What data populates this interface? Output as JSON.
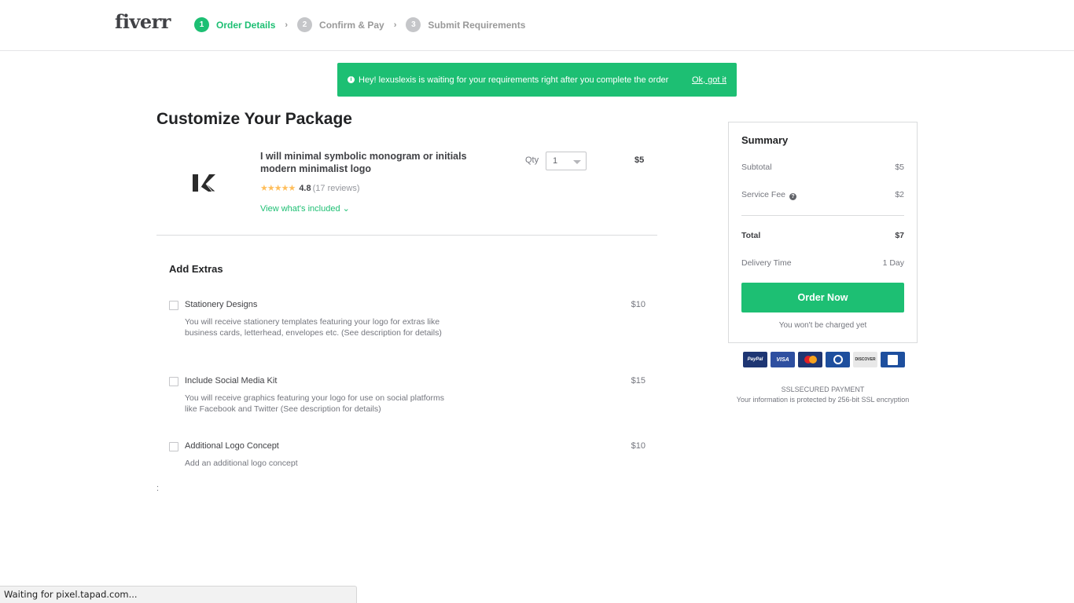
{
  "header": {
    "logo": "fiverr",
    "steps": [
      {
        "num": "1",
        "label": "Order Details",
        "active": true
      },
      {
        "num": "2",
        "label": "Confirm & Pay",
        "active": false
      },
      {
        "num": "3",
        "label": "Submit Requirements",
        "active": false
      }
    ],
    "step_separator": "›"
  },
  "banner": {
    "icon": "info-icon",
    "message": "Hey! lexuslexis is waiting for your requirements right after you complete the order",
    "dismiss_label": "Ok, got it",
    "color": "#1dbf73"
  },
  "page": {
    "title": "Customize Your Package"
  },
  "gig": {
    "title": "I will minimal symbolic monogram or initials modern minimalist logo",
    "stars": "★★★★★",
    "rating": "4.8",
    "reviews": "(17 reviews)",
    "view_included": "View what's included ⌄",
    "qty_label": "Qty",
    "qty_value": "1",
    "price": "$5"
  },
  "extras": {
    "title": "Add Extras",
    "items": [
      {
        "name": "Stationery Designs",
        "description": "You will receive stationery templates featuring your logo for extras like business cards, letterhead, envelopes etc. (See description for details)",
        "price": "$10",
        "checked": false
      },
      {
        "name": "Include Social Media Kit",
        "description": "You will receive graphics featuring your logo for use on social platforms like Facebook and Twitter (See description for details)",
        "price": "$15",
        "checked": false
      },
      {
        "name": "Additional Logo Concept",
        "description": "Add an additional logo concept",
        "price": "$10",
        "checked": false
      }
    ],
    "stray_text": ":"
  },
  "summary": {
    "title": "Summary",
    "subtotal_label": "Subtotal",
    "subtotal": "$5",
    "service_fee_label": "Service Fee",
    "service_fee_icon": "?",
    "service_fee": "$2",
    "total_label": "Total",
    "total": "$7",
    "delivery_label": "Delivery Time",
    "delivery": "1 Day",
    "order_button": "Order Now",
    "not_charged": "You won't be charged yet"
  },
  "payment": {
    "cards": [
      "PayPal",
      "VISA",
      "MasterCard",
      "Diners Club",
      "DISCOVER",
      "JCB"
    ],
    "secure_title": "SSLSECURED PAYMENT",
    "secure_sub": "Your information is protected by 256-bit SSL encryption"
  },
  "statusbar": {
    "text": "Waiting for pixel.tapad.com..."
  }
}
